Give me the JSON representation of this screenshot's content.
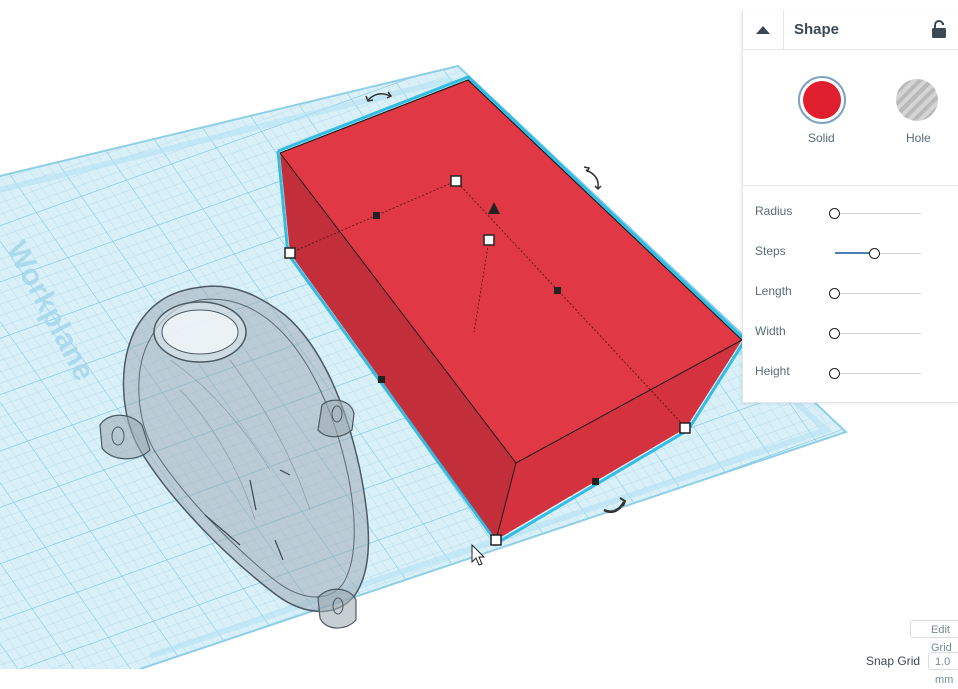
{
  "workplane": {
    "label": "Workplane"
  },
  "inspector": {
    "title": "Shape",
    "solid_label": "Solid",
    "hole_label": "Hole",
    "solid_color": "#e01f2e",
    "properties": [
      {
        "label": "Radius",
        "level": 0.0
      },
      {
        "label": "Steps",
        "level": 0.47
      },
      {
        "label": "Length",
        "level": 0.0
      },
      {
        "label": "Width",
        "level": 0.0
      },
      {
        "label": "Height",
        "level": 0.0
      }
    ]
  },
  "bottom": {
    "edit_grid_label": "Edit Grid",
    "snap_grid_label": "Snap Grid",
    "snap_grid_value": "1.0 mm"
  },
  "colors": {
    "box_top": "#e03844",
    "box_front": "#c22f3a",
    "box_side": "#d3323e",
    "grid": "#bfe4f2",
    "selection": "#16b4e0"
  }
}
